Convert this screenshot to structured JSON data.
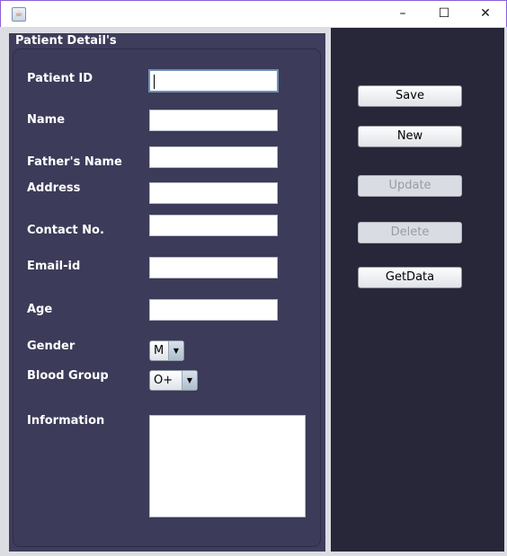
{
  "window": {
    "icon": "java-icon",
    "minimize": "–",
    "maximize": "☐",
    "close": "✕"
  },
  "panel": {
    "title": "Patient Detail's"
  },
  "form": {
    "patient_id": {
      "label": "Patient ID",
      "value": ""
    },
    "name": {
      "label": "Name",
      "value": ""
    },
    "fathers_name": {
      "label": "Father's Name",
      "value": ""
    },
    "address": {
      "label": "Address",
      "value": ""
    },
    "contact": {
      "label": "Contact No.",
      "value": ""
    },
    "email": {
      "label": "Email-id",
      "value": ""
    },
    "age": {
      "label": "Age",
      "value": ""
    },
    "gender": {
      "label": "Gender",
      "selected": "M"
    },
    "blood_group": {
      "label": "Blood Group",
      "selected": "O+"
    },
    "information": {
      "label": "Information",
      "value": ""
    }
  },
  "buttons": {
    "save": "Save",
    "new": "New",
    "update": "Update",
    "delete": "Delete",
    "getdata": "GetData"
  },
  "colors": {
    "panel": "#3e3d5c",
    "sidebar": "#272739"
  }
}
